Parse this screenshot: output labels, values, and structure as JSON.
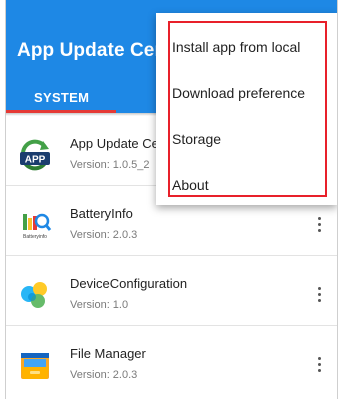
{
  "app": {
    "title": "App Update Center"
  },
  "tabs": [
    {
      "label": "SYSTEM"
    }
  ],
  "colors": {
    "toolbar": "#1e88e5",
    "tab_indicator": "#e53935",
    "highlight_box": "#e8202a"
  },
  "apps": [
    {
      "name": "App Update Center",
      "version": "Version: 1.0.5_2",
      "icon": "app-update-icon"
    },
    {
      "name": "BatteryInfo",
      "version": "Version: 2.0.3",
      "icon": "battery-info-icon"
    },
    {
      "name": "DeviceConfiguration",
      "version": "Version: 1.0",
      "icon": "device-config-icon"
    },
    {
      "name": "File Manager",
      "version": "Version: 2.0.3",
      "icon": "folder-icon"
    }
  ],
  "menu": {
    "items": [
      {
        "label": "Install app from local"
      },
      {
        "label": "Download preference"
      },
      {
        "label": "Storage"
      },
      {
        "label": "About"
      }
    ]
  }
}
